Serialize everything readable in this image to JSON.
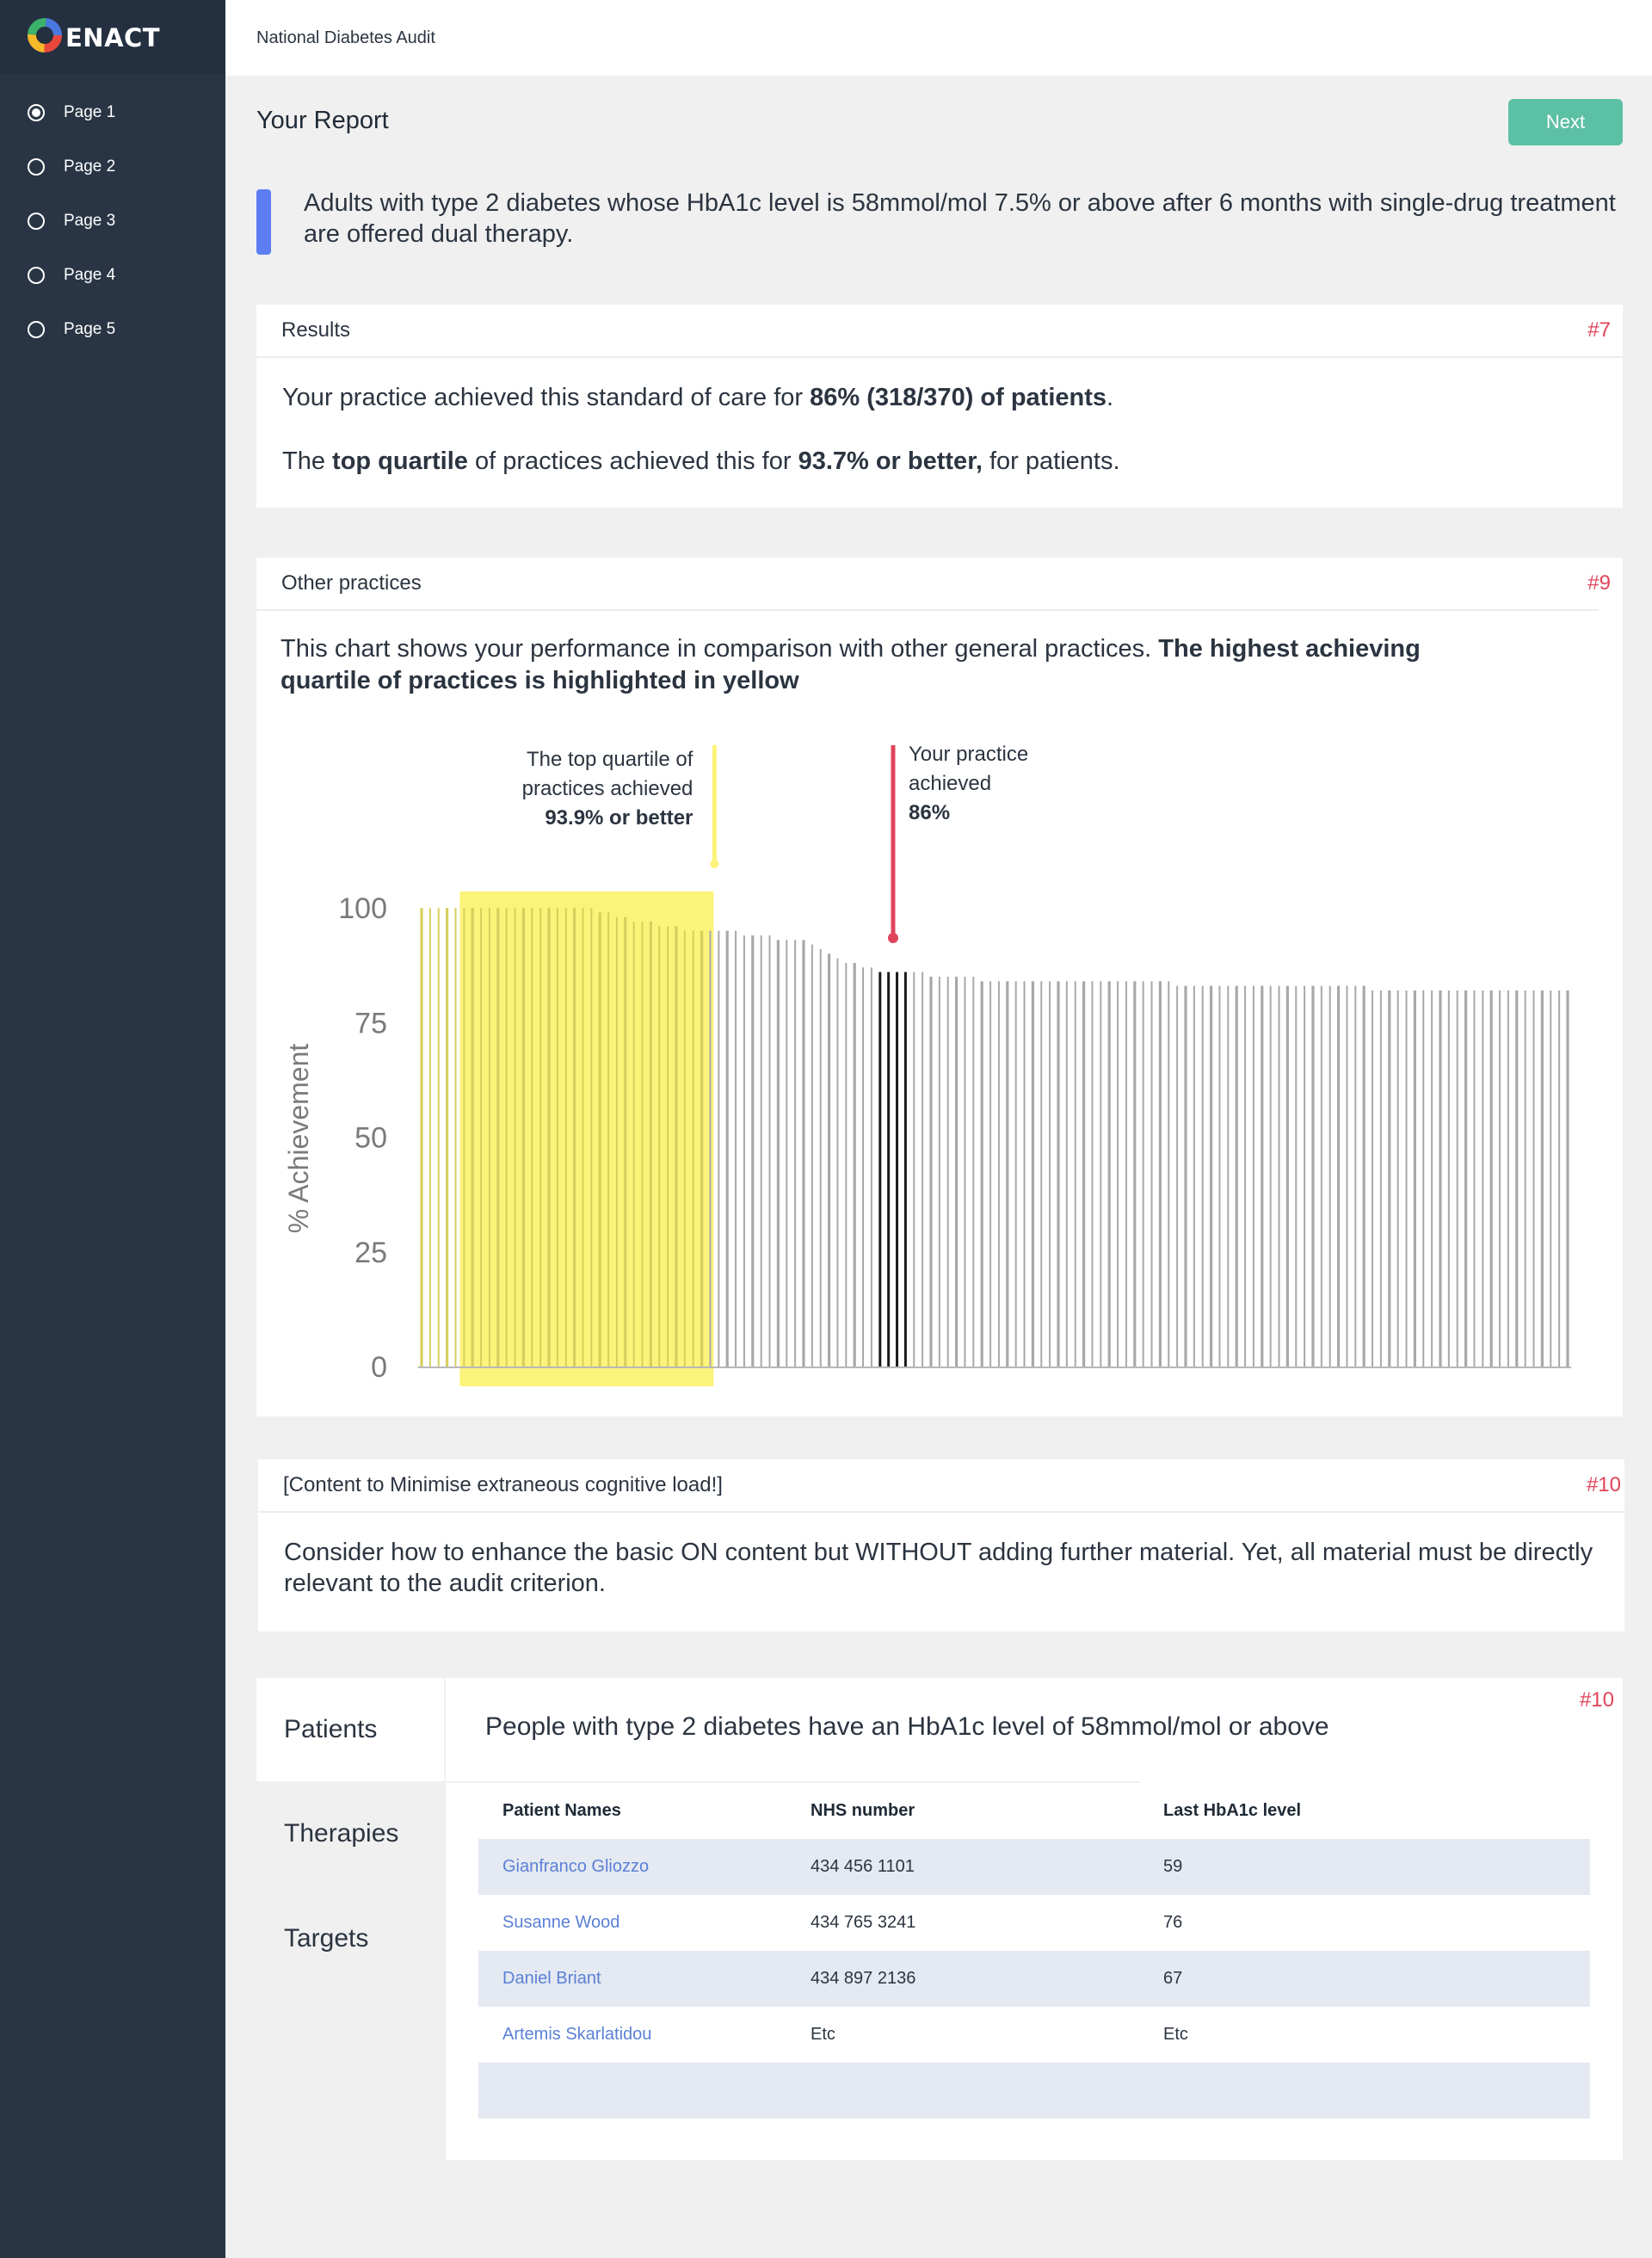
{
  "brand": {
    "name": "ENACT"
  },
  "sidebar": {
    "items": [
      {
        "label": "Page 1",
        "selected": true
      },
      {
        "label": "Page 2",
        "selected": false
      },
      {
        "label": "Page 3",
        "selected": false
      },
      {
        "label": "Page 4",
        "selected": false
      },
      {
        "label": "Page 5",
        "selected": false
      }
    ]
  },
  "topbar": {
    "title": "National Diabetes Audit"
  },
  "header": {
    "title": "Your Report",
    "next_label": "Next"
  },
  "criterion": {
    "text": "Adults with type 2 diabetes whose HbA1c level is 58mmol/mol 7.5% or above after 6 months with single-drug treatment are offered dual therapy."
  },
  "results": {
    "title": "Results",
    "number": "#7",
    "line1_a": "Your practice achieved this standard of care for ",
    "line1_b": "86% (318/370) of patients",
    "line1_c": ".",
    "line2_a": "The ",
    "line2_b": "top quartile",
    "line2_c": " of practices achieved this for ",
    "line2_d": "93.7% or better,",
    "line2_e": " for patients."
  },
  "other_practices": {
    "title": "Other practices",
    "number": "#9",
    "intro_a": "This chart shows your performance in comparison with other general practices. ",
    "intro_b": "The highest achieving quartile of practices is highlighted in yellow"
  },
  "chart_data": {
    "type": "bar",
    "ylabel": "% Achievement",
    "ylim": [
      0,
      100
    ],
    "yticks": [
      0,
      25,
      50,
      75,
      100
    ],
    "n_practices": 136,
    "values": [
      100,
      100,
      100,
      100,
      100,
      100,
      100,
      100,
      100,
      100,
      100,
      100,
      100,
      100,
      100,
      100,
      100,
      100,
      100,
      100,
      100,
      99,
      99,
      98,
      98,
      97,
      97,
      97,
      96,
      96,
      96,
      95,
      95,
      95,
      95,
      95,
      95,
      95,
      94,
      94,
      94,
      94,
      93,
      93,
      93,
      93,
      92,
      91,
      90,
      89,
      88,
      88,
      87,
      87,
      86,
      86,
      86,
      86,
      86,
      86,
      85,
      85,
      85,
      85,
      85,
      85,
      84,
      84,
      84,
      84,
      84,
      84,
      84,
      84,
      84,
      84,
      84,
      84,
      84,
      84,
      84,
      84,
      84,
      84,
      84,
      84,
      84,
      84,
      84,
      83,
      83,
      83,
      83,
      83,
      83,
      83,
      83,
      83,
      83,
      83,
      83,
      83,
      83,
      83,
      83,
      83,
      83,
      83,
      83,
      83,
      83,
      83,
      82,
      82,
      82,
      82,
      82,
      82,
      82,
      82,
      82,
      82,
      82,
      82,
      82,
      82,
      82,
      82,
      82,
      82,
      82,
      82,
      82,
      82,
      82,
      82
    ],
    "your_practice_value": 86,
    "top_quartile_label_a": "The top quartile of",
    "top_quartile_label_b": "practices achieved",
    "top_quartile_label_c": "93.9% or better",
    "your_practice_label_a": "Your practice",
    "your_practice_label_b": "achieved",
    "your_practice_label_c": "86%",
    "highlight_color": "#fcf37a",
    "marker_color": "#e0445a",
    "bar_color": "#a8a8a8"
  },
  "content_card": {
    "title": "[Content to Minimise extraneous cognitive load!]",
    "number": "#10",
    "text": "Consider how to enhance the basic ON content but WITHOUT adding further material.  Yet, all material must be directly relevant to the audit criterion."
  },
  "patients_section": {
    "tabs": [
      "Patients",
      "Therapies",
      "Targets"
    ],
    "heading": "People with type 2 diabetes have an HbA1c level of 58mmol/mol or above",
    "number": "#10",
    "columns": [
      "Patient Names",
      "NHS number",
      "Last HbA1c level"
    ],
    "rows": [
      {
        "name": "Gianfranco Gliozzo",
        "nhs": "434 456 1101",
        "hba1c": "59"
      },
      {
        "name": "Susanne Wood",
        "nhs": "434 765 3241",
        "hba1c": "76"
      },
      {
        "name": "Daniel Briant",
        "nhs": "434 897 2136",
        "hba1c": "67"
      },
      {
        "name": "Artemis Skarlatidou",
        "nhs": "Etc",
        "hba1c": "Etc"
      }
    ]
  }
}
